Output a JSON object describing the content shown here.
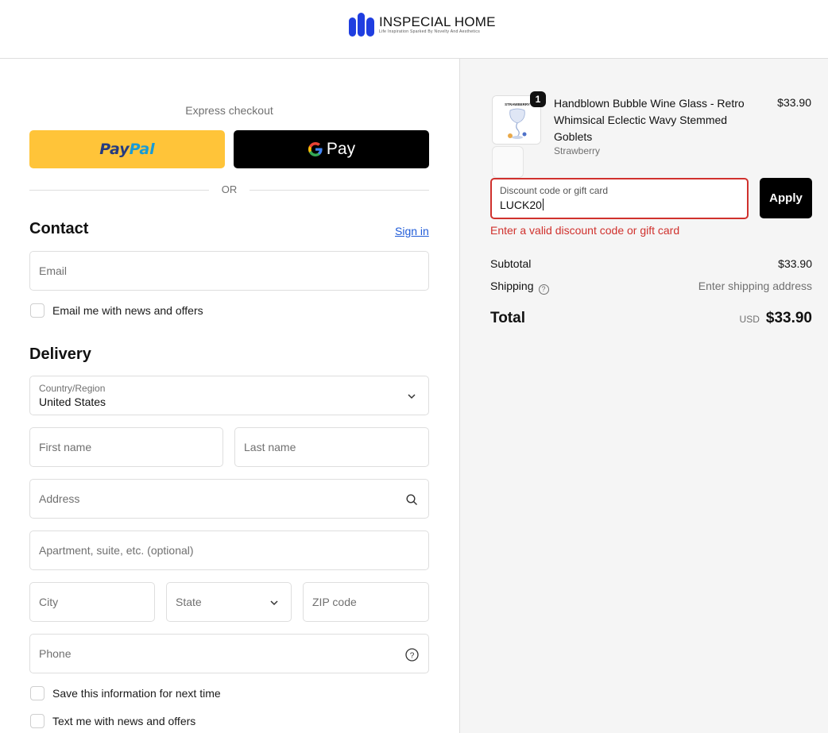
{
  "header": {
    "brand_name": "INSPECIAL HOME",
    "brand_tagline": "Life Inspiration Sparked By Novelty And Aesthetics"
  },
  "checkout": {
    "express_label": "Express checkout",
    "paypal_label_1": "Pay",
    "paypal_label_2": "Pal",
    "gpay_label": "Pay",
    "or_label": "OR"
  },
  "contact": {
    "title": "Contact",
    "sign_in": "Sign in",
    "email_placeholder": "Email",
    "newsletter_label": "Email me with news and offers"
  },
  "delivery": {
    "title": "Delivery",
    "country_label": "Country/Region",
    "country_value": "United States",
    "first_name": "First name",
    "last_name": "Last name",
    "address": "Address",
    "apartment": "Apartment, suite, etc. (optional)",
    "city": "City",
    "state": "State",
    "zip": "ZIP code",
    "phone": "Phone",
    "save_info_label": "Save this information for next time",
    "text_offers_label": "Text me with news and offers"
  },
  "order": {
    "quantity": "1",
    "product_name": "Handblown Bubble Wine Glass - Retro Whimsical Eclectic Wavy Stemmed Goblets",
    "product_variant": "Strawberry",
    "product_price": "$33.90",
    "thumb_label": "STRAWBERRY",
    "discount_label": "Discount code or gift card",
    "discount_value": "LUCK20",
    "apply_label": "Apply",
    "error_message": "Enter a valid discount code or gift card",
    "subtotal_label": "Subtotal",
    "subtotal_value": "$33.90",
    "shipping_label": "Shipping",
    "shipping_value": "Enter shipping address",
    "total_label": "Total",
    "currency": "USD",
    "total_value": "$33.90"
  },
  "colors": {
    "paypal_yellow": "#ffc439",
    "brand_blue": "#1f3ee0",
    "error_red": "#d0312d",
    "link_blue": "#1f5bd8"
  }
}
